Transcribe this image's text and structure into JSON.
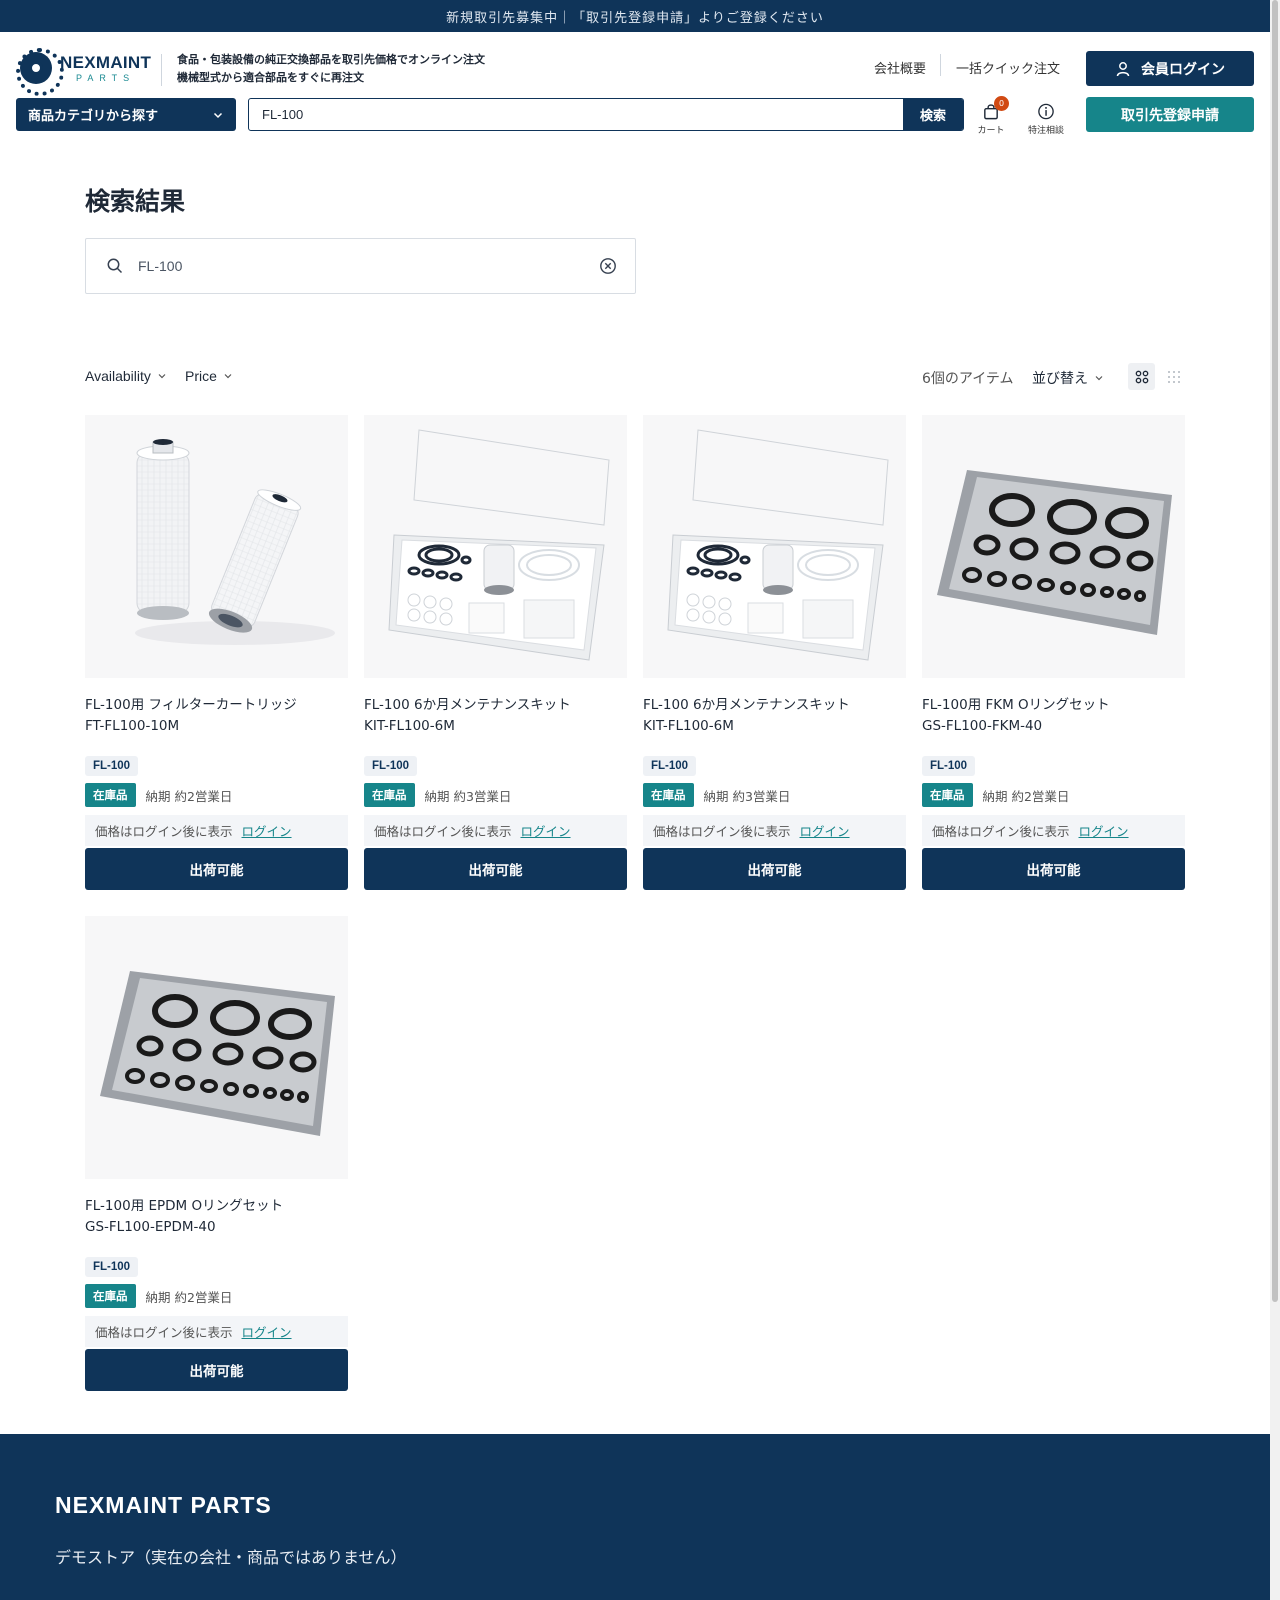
{
  "announcement": "新規取引先募集中｜「取引先登録申請」よりご登録ください",
  "brand": {
    "logo_main": "NEXMAINT",
    "logo_sub": "PARTS",
    "tagline_line1": "食品・包装設備の純正交換部品を取引先価格でオンライン注文",
    "tagline_line2": "機械型式から適合部品をすぐに再注文"
  },
  "header": {
    "company_link": "会社概要",
    "quick_order_link": "一括クイック注文",
    "login_button": "会員ログイン",
    "category_dropdown": "商品カテゴリから探す",
    "search_value": "FL-100",
    "search_button": "検索",
    "cart_label": "カート",
    "cart_count": "0",
    "special_order_label": "特注相談",
    "register_button": "取引先登録申請"
  },
  "results": {
    "page_title": "検索結果",
    "search_value": "FL-100",
    "filters": [
      "Availability",
      "Price"
    ],
    "item_count": "6個のアイテム",
    "sort_label": "並び替え"
  },
  "products": [
    {
      "name": "FL-100用 フィルターカートリッジ",
      "sku": "FT-FL100-10M",
      "model": "FL-100",
      "stock": "在庫品",
      "lead": "納期 約2営業日",
      "price_note": "価格はログイン後に表示",
      "login": "ログイン",
      "button": "出荷可能",
      "image": "filter-cartridge"
    },
    {
      "name": "FL-100 6か月メンテナンスキット",
      "sku": "KIT-FL100-6M",
      "model": "FL-100",
      "stock": "在庫品",
      "lead": "納期 約3営業日",
      "price_note": "価格はログイン後に表示",
      "login": "ログイン",
      "button": "出荷可能",
      "image": "maintenance-kit"
    },
    {
      "name": "FL-100 6か月メンテナンスキット",
      "sku": "KIT-FL100-6M",
      "model": "FL-100",
      "stock": "在庫品",
      "lead": "納期 約3営業日",
      "price_note": "価格はログイン後に表示",
      "login": "ログイン",
      "button": "出荷可能",
      "image": "maintenance-kit"
    },
    {
      "name": "FL-100用 FKM Oリングセット",
      "sku": "GS-FL100-FKM-40",
      "model": "FL-100",
      "stock": "在庫品",
      "lead": "納期 約2営業日",
      "price_note": "価格はログイン後に表示",
      "login": "ログイン",
      "button": "出荷可能",
      "image": "oring-tray"
    },
    {
      "name": "FL-100用 EPDM Oリングセット",
      "sku": "GS-FL100-EPDM-40",
      "model": "FL-100",
      "stock": "在庫品",
      "lead": "納期 約2営業日",
      "price_note": "価格はログイン後に表示",
      "login": "ログイン",
      "button": "出荷可能",
      "image": "oring-tray"
    }
  ],
  "footer": {
    "brand": "NEXMAINT PARTS",
    "note": "デモストア（実在の会社・商品ではありません）"
  },
  "colors": {
    "navy": "#0f3459",
    "teal": "#16858a",
    "badge_orange": "#d14a13"
  }
}
